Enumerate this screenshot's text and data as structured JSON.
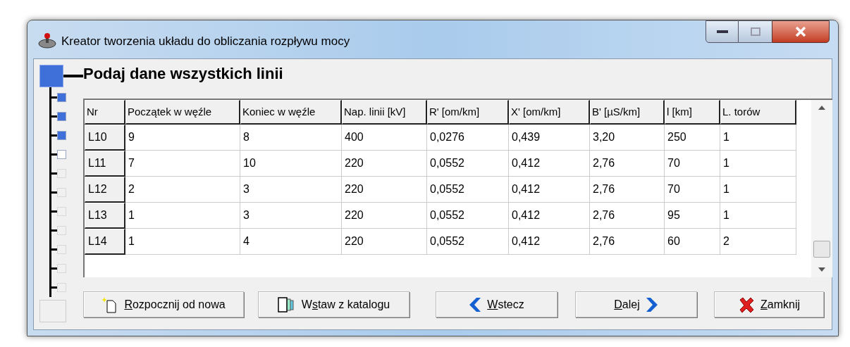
{
  "window": {
    "title": "Kreator tworzenia układu do obliczania rozpływu mocy"
  },
  "heading": "Podaj dane wszystkich linii",
  "steps": [
    {
      "completed": true,
      "disabled": false
    },
    {
      "completed": true,
      "disabled": false
    },
    {
      "completed": true,
      "disabled": false
    },
    {
      "completed": false,
      "disabled": false
    },
    {
      "completed": false,
      "disabled": true
    },
    {
      "completed": false,
      "disabled": true
    },
    {
      "completed": false,
      "disabled": true
    },
    {
      "completed": false,
      "disabled": true
    },
    {
      "completed": false,
      "disabled": true
    },
    {
      "completed": false,
      "disabled": true
    },
    {
      "completed": false,
      "disabled": true
    }
  ],
  "table": {
    "columns": [
      "Nr",
      "Początek w węźle",
      "Koniec w węźle",
      "Nap. linii [kV]",
      "R'  [om/km]",
      "X'  [om/km]",
      "B'  [µS/km]",
      "l [km]",
      "L. torów"
    ],
    "rows": [
      [
        "L10",
        "9",
        "8",
        "400",
        "0,0276",
        "0,439",
        "3,20",
        "250",
        "1"
      ],
      [
        "L11",
        "7",
        "10",
        "220",
        "0,0552",
        "0,412",
        "2,76",
        "70",
        "1"
      ],
      [
        "L12",
        "2",
        "3",
        "220",
        "0,0552",
        "0,412",
        "2,76",
        "70",
        "1"
      ],
      [
        "L13",
        "1",
        "3",
        "220",
        "0,0552",
        "0,412",
        "2,76",
        "95",
        "1"
      ],
      [
        "L14",
        "1",
        "4",
        "220",
        "0,0552",
        "0,412",
        "2,76",
        "60",
        "2"
      ]
    ]
  },
  "buttons": [
    {
      "kind": "new",
      "key": "R",
      "after": "ozpocznij od nowa"
    },
    {
      "kind": "catalog",
      "before": "W",
      "key": "s",
      "after": "taw z katalogu"
    },
    {
      "kind": "back",
      "key": "W",
      "after": "stecz"
    },
    {
      "kind": "next",
      "key": "D",
      "after": "alej"
    },
    {
      "kind": "close",
      "key": "Z",
      "after": "amknij"
    }
  ]
}
